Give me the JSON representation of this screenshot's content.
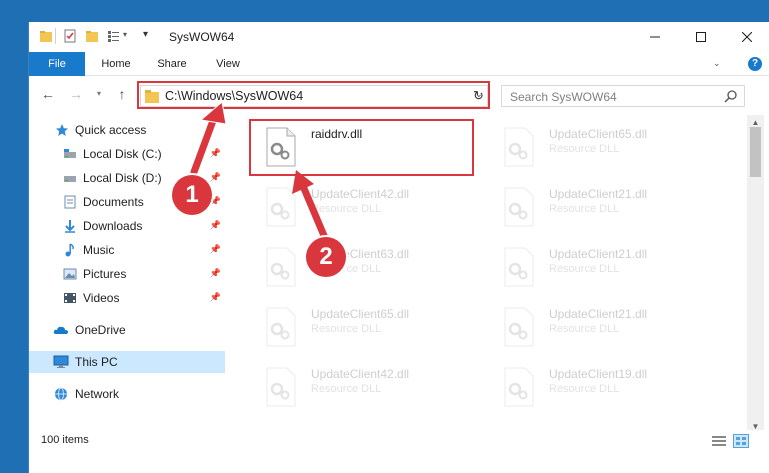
{
  "window": {
    "title": "SysWOW64",
    "minimize_icon": "minimize-icon",
    "maximize_icon": "maximize-icon",
    "close_icon": "close-icon"
  },
  "ribbon": {
    "tabs": [
      {
        "label": "File"
      },
      {
        "label": "Home"
      },
      {
        "label": "Share"
      },
      {
        "label": "View"
      }
    ],
    "help_label": "?"
  },
  "navigation": {
    "address_path": "C:\\Windows\\SysWOW64",
    "search_placeholder": "Search SysWOW64"
  },
  "sidebar": {
    "items": [
      {
        "label": "Quick access",
        "icon": "star-icon",
        "pinned": false
      },
      {
        "label": "Local Disk (C:)",
        "icon": "drive-icon",
        "pinned": true
      },
      {
        "label": "Local Disk (D:)",
        "icon": "drive-icon",
        "pinned": true
      },
      {
        "label": "Documents",
        "icon": "documents-icon",
        "pinned": true
      },
      {
        "label": "Downloads",
        "icon": "downloads-icon",
        "pinned": true
      },
      {
        "label": "Music",
        "icon": "music-icon",
        "pinned": true
      },
      {
        "label": "Pictures",
        "icon": "pictures-icon",
        "pinned": true
      },
      {
        "label": "Videos",
        "icon": "videos-icon",
        "pinned": true
      },
      {
        "label": "OneDrive",
        "icon": "cloud-icon",
        "pinned": false
      },
      {
        "label": "This PC",
        "icon": "computer-icon",
        "pinned": false,
        "selected": true
      },
      {
        "label": "Network",
        "icon": "network-icon",
        "pinned": false
      }
    ]
  },
  "files": {
    "left": [
      {
        "name": "raiddrv.dll",
        "type": "",
        "highlighted": true
      },
      {
        "name": "UpdateClient42.dll",
        "type": "Resource DLL"
      },
      {
        "name": "UpdateClient63.dll",
        "type": "Resource DLL"
      },
      {
        "name": "UpdateClient65.dll",
        "type": "Resource DLL"
      },
      {
        "name": "UpdateClient42.dll",
        "type": "Resource DLL"
      }
    ],
    "right": [
      {
        "name": "UpdateClient65.dll",
        "type": "Resource DLL"
      },
      {
        "name": "UpdateClient21.dll",
        "type": "Resource DLL"
      },
      {
        "name": "UpdateClient21.dll",
        "type": "Resource DLL"
      },
      {
        "name": "UpdateClient21.dll",
        "type": "Resource DLL"
      },
      {
        "name": "UpdateClient19.dll",
        "type": "Resource DLL"
      }
    ]
  },
  "status": {
    "item_count": "100 items"
  },
  "annotations": {
    "step1": "1",
    "step2": "2",
    "color": "#d9363e"
  },
  "colors": {
    "accent": "#1979ca",
    "selected_bg": "#cce8ff",
    "folder": "#f3c654"
  }
}
